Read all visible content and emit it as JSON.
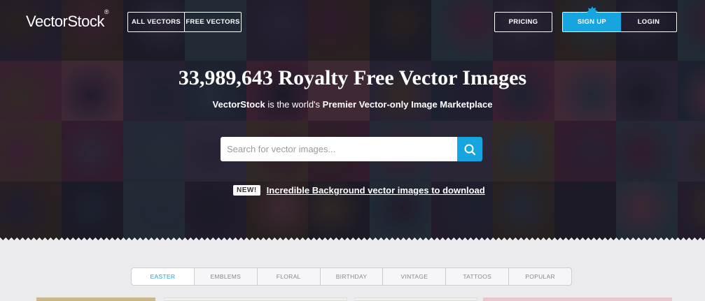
{
  "brand": {
    "logo_text": "VectorStock",
    "logo_mark": "®",
    "accent_color": "#17a5e0"
  },
  "nav": {
    "all_vectors": "ALL VECTORS",
    "free_vectors": "FREE VECTORS",
    "pricing": "PRICING",
    "sign_up": "SIGN UP",
    "login": "LOGIN"
  },
  "hero": {
    "headline": "33,989,643 Royalty Free Vector Images",
    "sub_brand": "VectorStock",
    "sub_middle": " is the world's ",
    "sub_strong": "Premier Vector-only Image Marketplace"
  },
  "search": {
    "placeholder": "Search for vector images...",
    "icon": "search-icon"
  },
  "promo": {
    "badge": "NEW!",
    "link": "Incredible Background vector images to download"
  },
  "tabs": [
    {
      "label": "EASTER",
      "active": true
    },
    {
      "label": "EMBLEMS",
      "active": false
    },
    {
      "label": "FLORAL",
      "active": false
    },
    {
      "label": "BIRTHDAY",
      "active": false
    },
    {
      "label": "VINTAGE",
      "active": false
    },
    {
      "label": "TATTOOS",
      "active": false
    },
    {
      "label": "POPULAR",
      "active": false
    }
  ]
}
